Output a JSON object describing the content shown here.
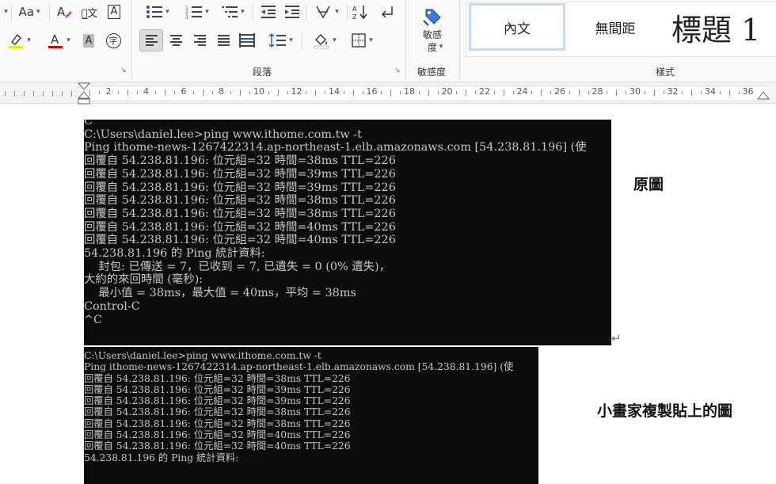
{
  "ribbon": {
    "font_row": {
      "change_case": "Aa",
      "clear_format_glyph": "A",
      "phonetic_guide": "中̲文",
      "char_border": "A"
    },
    "font_row2": {
      "font_color": "A",
      "char_shading": "A",
      "enclose_char": "字"
    },
    "groups": {
      "paragraph": "段落",
      "sensitivity": "敏感度",
      "styles": "樣式"
    },
    "sensitivity_button": "敏感\n度",
    "styles": [
      {
        "label": "內文",
        "selected": true
      },
      {
        "label": "無間距",
        "selected": false
      },
      {
        "label": "標題 1",
        "selected": false
      }
    ],
    "colors": {
      "highlight": "#f2e600",
      "font_color": "#d00000",
      "selected_style_border": "#c5d9f1"
    }
  },
  "ruler": {
    "numbers": [
      "2",
      "4",
      "6",
      "8",
      "10",
      "12",
      "14",
      "16",
      "18",
      "20",
      "22",
      "24",
      "26",
      "28",
      "30",
      "32",
      "34",
      "36"
    ]
  },
  "document": {
    "console_original": [
      "C",
      "C:\\Users\\daniel.lee>ping www.ithome.com.tw -t",
      "",
      "Ping ithome-news-1267422314.ap-northeast-1.elb.amazonaws.com [54.238.81.196] (使",
      "回覆自 54.238.81.196: 位元組=32 時間=38ms TTL=226",
      "回覆自 54.238.81.196: 位元組=32 時間=39ms TTL=226",
      "回覆自 54.238.81.196: 位元組=32 時間=39ms TTL=226",
      "回覆自 54.238.81.196: 位元組=32 時間=38ms TTL=226",
      "回覆自 54.238.81.196: 位元組=32 時間=38ms TTL=226",
      "回覆自 54.238.81.196: 位元組=32 時間=40ms TTL=226",
      "回覆自 54.238.81.196: 位元組=32 時間=40ms TTL=226",
      "",
      "54.238.81.196 的 Ping 統計資料:",
      "    封包: 已傳送 = 7，已收到 = 7, 已遺失 = 0 (0% 遺失)，",
      "大約的來回時間 (毫秒):",
      "    最小值 = 38ms，最大值 = 40ms，平均 = 38ms",
      "Control-C",
      "^C"
    ],
    "console_pasted": [
      "C:\\Users\\daniel.lee>ping www.ithome.com.tw -t",
      "",
      "Ping ithome-news-1267422314.ap-northeast-1.elb.amazonaws.com [54.238.81.196] (使",
      "回覆自 54.238.81.196: 位元組=32 時間=38ms TTL=226",
      "回覆自 54.238.81.196: 位元組=32 時間=39ms TTL=226",
      "回覆自 54.238.81.196: 位元組=32 時間=39ms TTL=226",
      "回覆自 54.238.81.196: 位元組=32 時間=38ms TTL=226",
      "回覆自 54.238.81.196: 位元組=32 時間=38ms TTL=226",
      "回覆自 54.238.81.196: 位元組=32 時間=40ms TTL=226",
      "回覆自 54.238.81.196: 位元組=32 時間=40ms TTL=226",
      "",
      "54.238.81.196 的 Ping 統計資料:"
    ],
    "caption_original": "原圖",
    "caption_pasted": "小畫家複製貼上的圖",
    "paragraph_mark": "↵"
  }
}
